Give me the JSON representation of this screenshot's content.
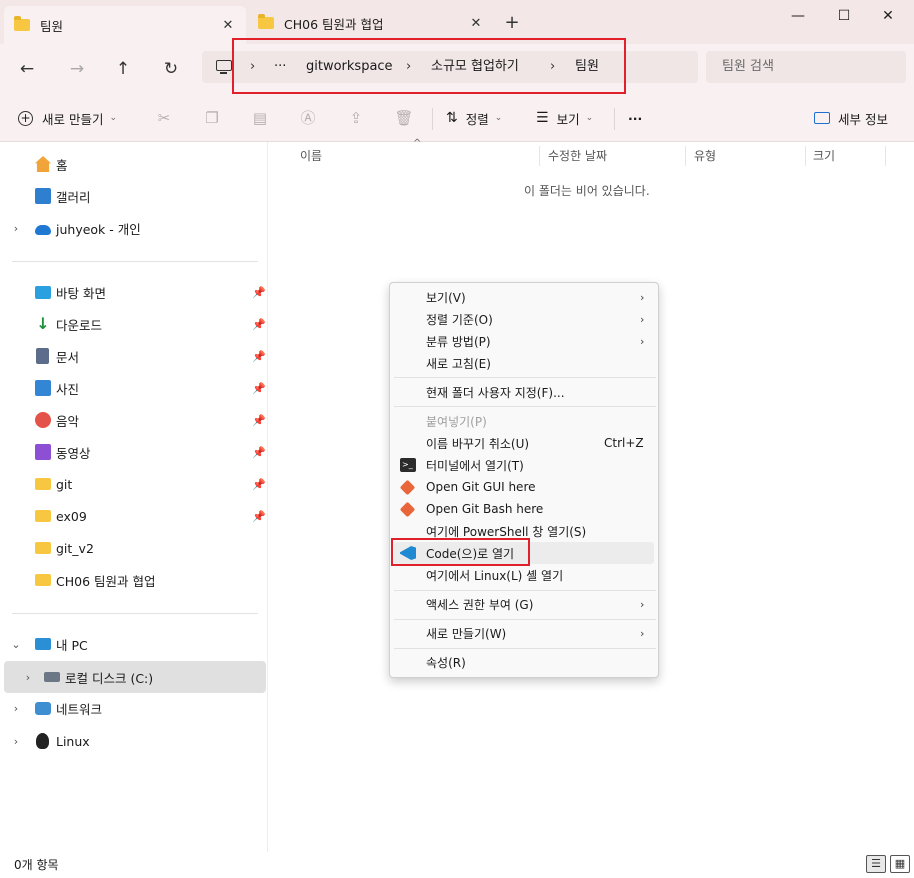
{
  "tabs": [
    {
      "label": "팀원",
      "active": true
    },
    {
      "label": "CH06 팀원과 협업",
      "active": false
    }
  ],
  "window_controls": {
    "minimize": "—",
    "maximize": "☐",
    "close": "✕",
    "new_tab": "+",
    "tab_close": "✕"
  },
  "nav": {
    "back": "←",
    "forward": "→",
    "up": "↑",
    "refresh": "↻"
  },
  "breadcrumb": {
    "overflow": "···",
    "separator": "›",
    "items": [
      "gitworkspace",
      "소규모 협업하기",
      "팀원"
    ]
  },
  "search": {
    "placeholder": "팀원 검색"
  },
  "toolbar": {
    "new_label": "새로 만들기",
    "sort_label": "정렬",
    "view_label": "보기",
    "more_label": "···",
    "details_label": "세부 정보",
    "chevron": "⌄"
  },
  "sidebar": {
    "top": [
      {
        "label": "홈",
        "icon": "home-icon"
      },
      {
        "label": "갤러리",
        "icon": "gallery-icon"
      },
      {
        "label": "juhyeok - 개인",
        "icon": "onedrive-icon",
        "expand": "›"
      }
    ],
    "pinned": [
      {
        "label": "바탕 화면",
        "icon": "desktop-icon"
      },
      {
        "label": "다운로드",
        "icon": "download-icon"
      },
      {
        "label": "문서",
        "icon": "documents-icon"
      },
      {
        "label": "사진",
        "icon": "pictures-icon"
      },
      {
        "label": "음악",
        "icon": "music-icon"
      },
      {
        "label": "동영상",
        "icon": "videos-icon"
      },
      {
        "label": "git",
        "icon": "folder-icon"
      },
      {
        "label": "ex09",
        "icon": "folder-icon"
      },
      {
        "label": "git_v2",
        "icon": "folder-icon"
      },
      {
        "label": "CH06 팀원과 협업",
        "icon": "folder-icon"
      }
    ],
    "pin_glyph": "📌",
    "devices": [
      {
        "label": "내 PC",
        "icon": "pc-icon",
        "expand": "⌄"
      },
      {
        "label": "로컬 디스크 (C:)",
        "icon": "disk-icon",
        "expand": "›"
      },
      {
        "label": "네트워크",
        "icon": "network-icon",
        "expand": "›"
      },
      {
        "label": "Linux",
        "icon": "linux-icon",
        "expand": "›"
      }
    ]
  },
  "columns": [
    "이름",
    "수정한 날짜",
    "유형",
    "크기"
  ],
  "sort_indicator": "^",
  "empty_message": "이 폴더는 비어 있습니다.",
  "status": {
    "item_count": "0개 항목"
  },
  "context_menu": {
    "items": [
      {
        "label": "보기(V)",
        "submenu": true
      },
      {
        "label": "정렬 기준(O)",
        "submenu": true
      },
      {
        "label": "분류 방법(P)",
        "submenu": true
      },
      {
        "label": "새로 고침(E)"
      },
      {
        "label": "현재 폴더 사용자 지정(F)..."
      },
      {
        "label": "붙여넣기(P)",
        "disabled": true
      },
      {
        "label": "이름 바꾸기 취소(U)",
        "shortcut": "Ctrl+Z"
      },
      {
        "label": "터미널에서 열기(T)",
        "icon": "terminal-icon"
      },
      {
        "label": "Open Git GUI here",
        "icon": "git-gui-icon"
      },
      {
        "label": "Open Git Bash here",
        "icon": "git-bash-icon"
      },
      {
        "label": "여기에 PowerShell 창 열기(S)"
      },
      {
        "label": "Code(으)로 열기",
        "icon": "vscode-icon",
        "highlighted": true
      },
      {
        "label": "여기에서 Linux(L) 셸 열기"
      },
      {
        "label": "액세스 권한 부여 (G)",
        "submenu": true
      },
      {
        "label": "새로 만들기(W)",
        "submenu": true
      },
      {
        "label": "속성(R)"
      }
    ],
    "arrow": "›"
  },
  "colors": {
    "highlight_border": "#e0202a",
    "titlebar_bg": "#f3e8e7",
    "folder": "#f7c742"
  }
}
